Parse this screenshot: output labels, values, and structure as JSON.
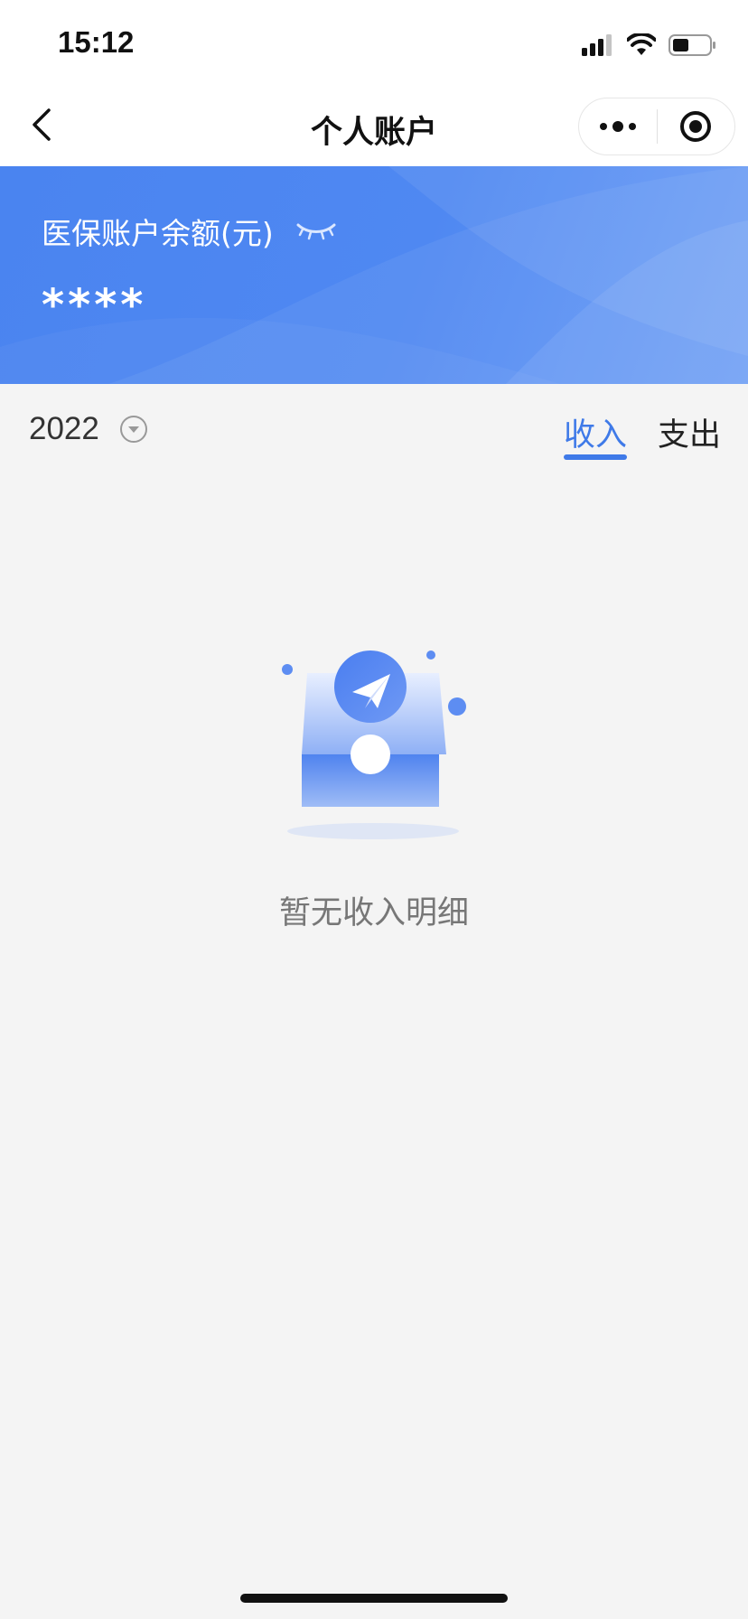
{
  "status_bar": {
    "time": "15:12",
    "icons": [
      "signal-icon",
      "wifi-icon",
      "battery-icon"
    ]
  },
  "nav": {
    "title": "个人账户",
    "back_icon": "chevron-left-icon",
    "more_icon": "more-dots-icon",
    "close_icon": "target-close-icon"
  },
  "balance": {
    "label": "医保账户余额(元)",
    "value": "****",
    "toggle_icon": "eye-closed-icon"
  },
  "filter": {
    "year": "2022",
    "year_icon": "dropdown-circle-icon",
    "tabs": [
      {
        "label": "收入",
        "active": true
      },
      {
        "label": "支出",
        "active": false
      }
    ]
  },
  "empty_state": {
    "icon": "empty-inbox-icon",
    "text": "暂无收入明细"
  },
  "colors": {
    "accent": "#3f7ae8",
    "banner": "#4a84f0",
    "background": "#f4f4f4"
  }
}
